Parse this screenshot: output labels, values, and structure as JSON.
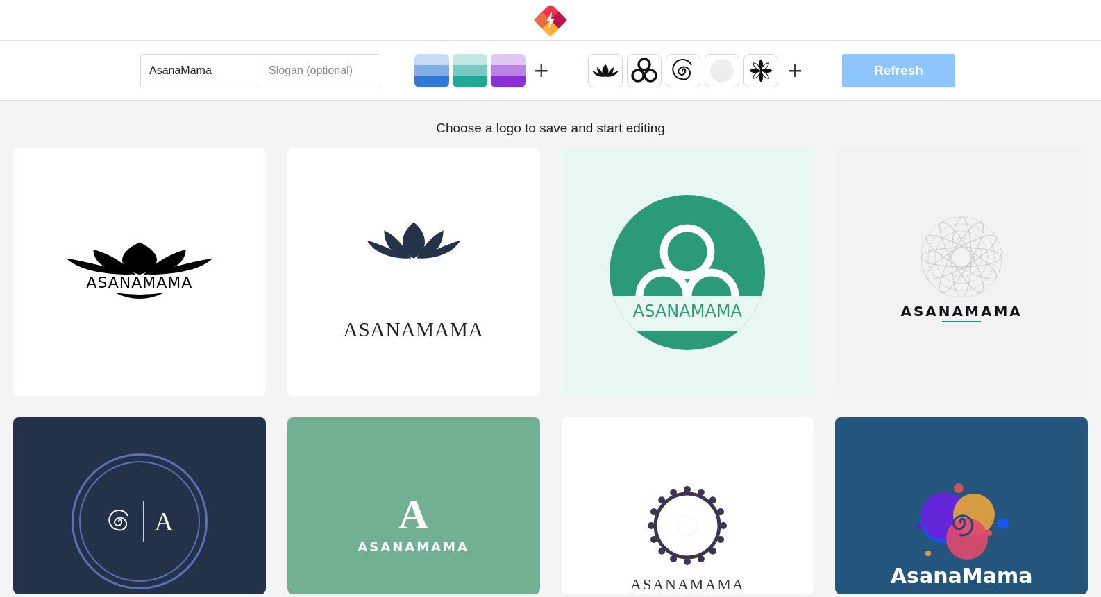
{
  "toolbar": {
    "name_field": {
      "value": "AsanaMama"
    },
    "slogan_field": {
      "placeholder": "Slogan (optional)"
    },
    "palettes": [
      {
        "color": "#2f78d8",
        "selected": false
      },
      {
        "color": "#1fa899",
        "selected": false
      },
      {
        "color": "#8a2fd8",
        "selected": false
      }
    ],
    "add_palette": "+",
    "symbols": [
      {
        "kind": "lotus"
      },
      {
        "kind": "rings"
      },
      {
        "kind": "spiral"
      },
      {
        "kind": "mandala"
      },
      {
        "kind": "flower"
      }
    ],
    "add_symbol": "+",
    "refresh_button": {
      "label": "Refresh",
      "disabled": true
    }
  },
  "heading": "Choose a logo to save and start editing",
  "logos": [
    {
      "kind": "lotus-bold",
      "name": "ASANAMAMA",
      "color": "#ffffff"
    },
    {
      "kind": "lotus",
      "name": "ASANAMAMA",
      "color": "#ffffff"
    },
    {
      "kind": "circles",
      "name": "ASANAMAMA",
      "color": "#e9f7f2"
    },
    {
      "kind": "mandala",
      "name": "ASANAMAMA",
      "color": "#f2f2f2"
    },
    {
      "kind": "monogram",
      "name": "A",
      "color": "#233149"
    },
    {
      "kind": "letter",
      "name": "ASANAMAMA",
      "letter": "A",
      "color": "#72b094"
    },
    {
      "kind": "ornament",
      "name": "ASANAMAMA",
      "color": "#ffffff"
    },
    {
      "kind": "bubbles",
      "name": "AsanaMama",
      "color": "#24557c"
    }
  ]
}
